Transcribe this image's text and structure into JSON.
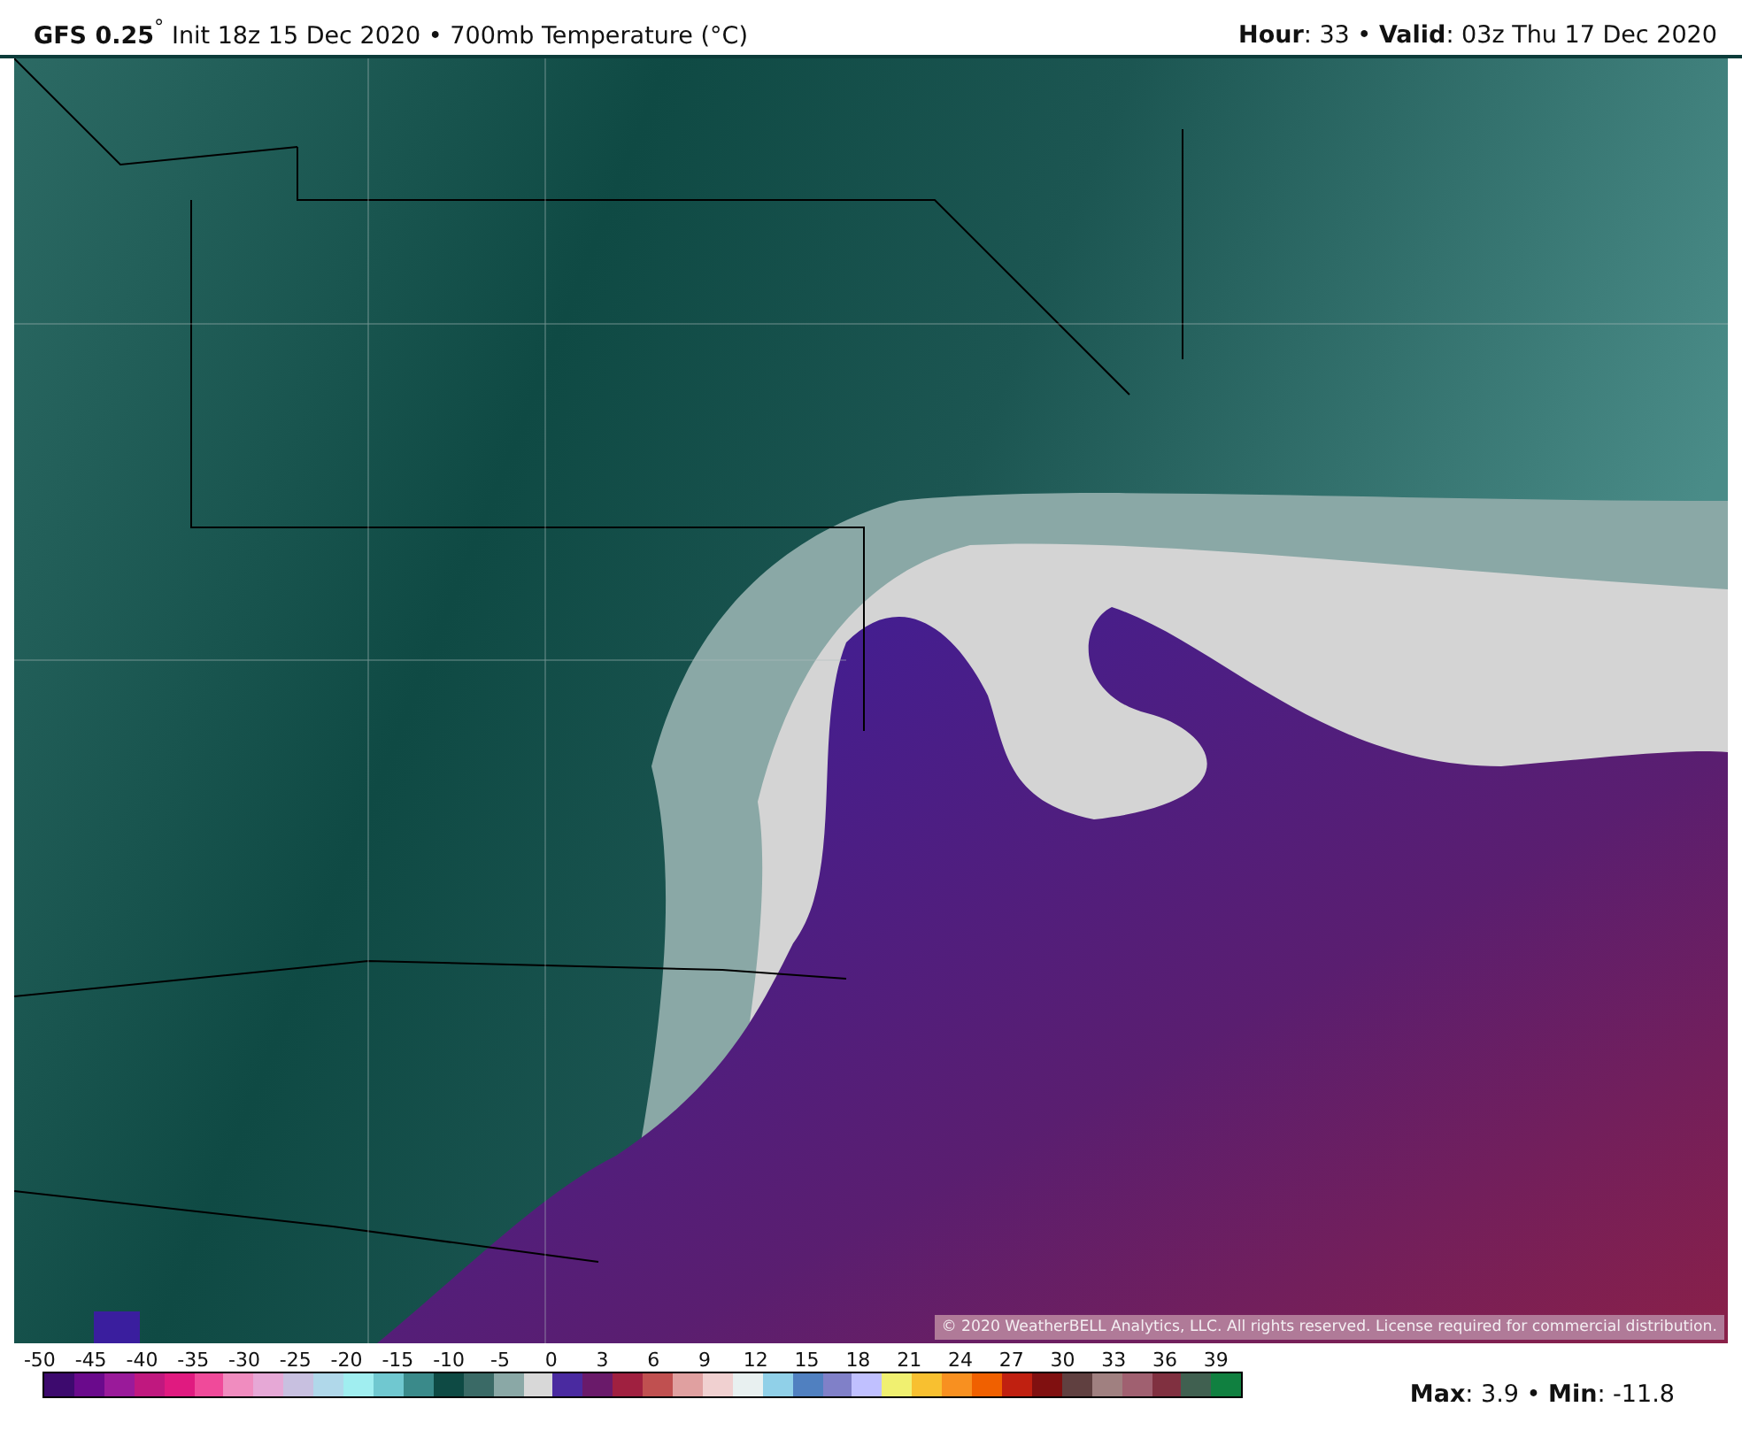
{
  "header": {
    "title": "**GFS 0.25**$^{°}$ Init 18z 15 Dec 2020 • 700mb Temperature (°C)",
    "valid": "**Hour**: 33 • **Valid**: 03z Thu 17 Dec 2020"
  },
  "map": {
    "copyright": "© 2020 WeatherBELL Analytics, LLC. All rights reserved. License required for commercial distribution."
  },
  "legend": {
    "ticks": [
      "-50",
      "-45",
      "-40",
      "-35",
      "-30",
      "-25",
      "-20",
      "-15",
      "-10",
      "-5",
      "0",
      "3",
      "6",
      "9",
      "12",
      "15",
      "18",
      "21",
      "24",
      "27",
      "30",
      "33",
      "36",
      "39"
    ],
    "stats": "**Max**: 3.9 • **Min**: -11.8"
  }
}
